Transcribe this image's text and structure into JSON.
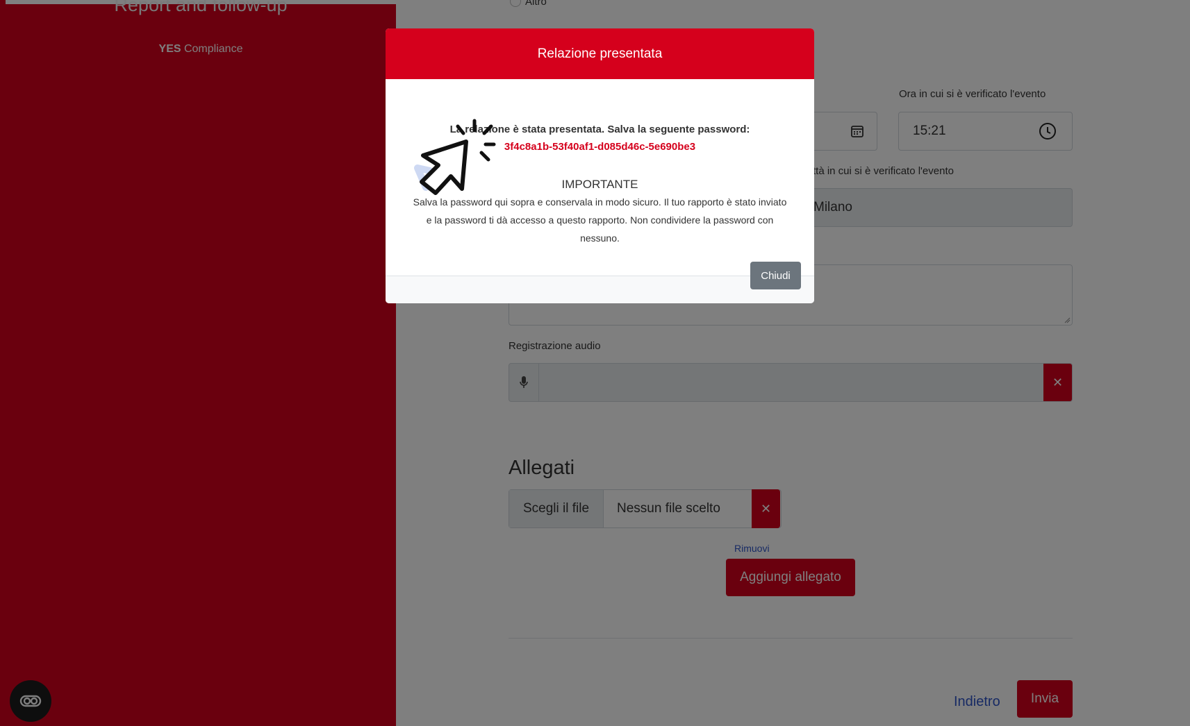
{
  "sidebar": {
    "title": "Report and follow-up",
    "brand_strong": "YES",
    "brand_rest": " Compliance"
  },
  "form": {
    "hidden_top_label": "Altro",
    "time_label": "Ora in cui si è verificato l'evento",
    "time_value": "15:21",
    "city_label": "ttà in cui si è verificato l'evento",
    "city_value": "Milano",
    "audio_label": "Registrazione audio",
    "attachments_title": "Allegati",
    "choose_file_label": "Scegli il file",
    "no_file_label": "Nessun file scelto",
    "remove_link": "Rimuovi",
    "add_attachment_button": "Aggiungi allegato",
    "back_link": "Indietro",
    "submit_button": "Invia"
  },
  "modal": {
    "title": "Relazione presentata",
    "intro": "La relazione è stata presentata. Salva la seguente password:",
    "password": "3f4c8a1b-53f40af1-d085d46c-5e690be3",
    "important_heading": "IMPORTANTE",
    "body_line1": "Salva la password qui sopra e conservala in modo sicuro. Il tuo rapporto è stato inviato",
    "body_line2": "e la password ti dà accesso a questo rapporto. Non condividere la password con",
    "body_line3": "nessuno.",
    "close_button": "Chiudi"
  },
  "icons": {
    "calendar": "calendar-icon",
    "clock": "clock-icon",
    "microphone": "microphone-icon",
    "clear_audio": "close-icon",
    "clear_file": "close-icon",
    "accessibility": "accessibility-icon",
    "pointer": "pointer-click-icon"
  },
  "colors": {
    "brand_red": "#d5001c",
    "password_red": "#d5001c",
    "link_blue": "#2f55c8",
    "close_gray": "#6c757d"
  }
}
